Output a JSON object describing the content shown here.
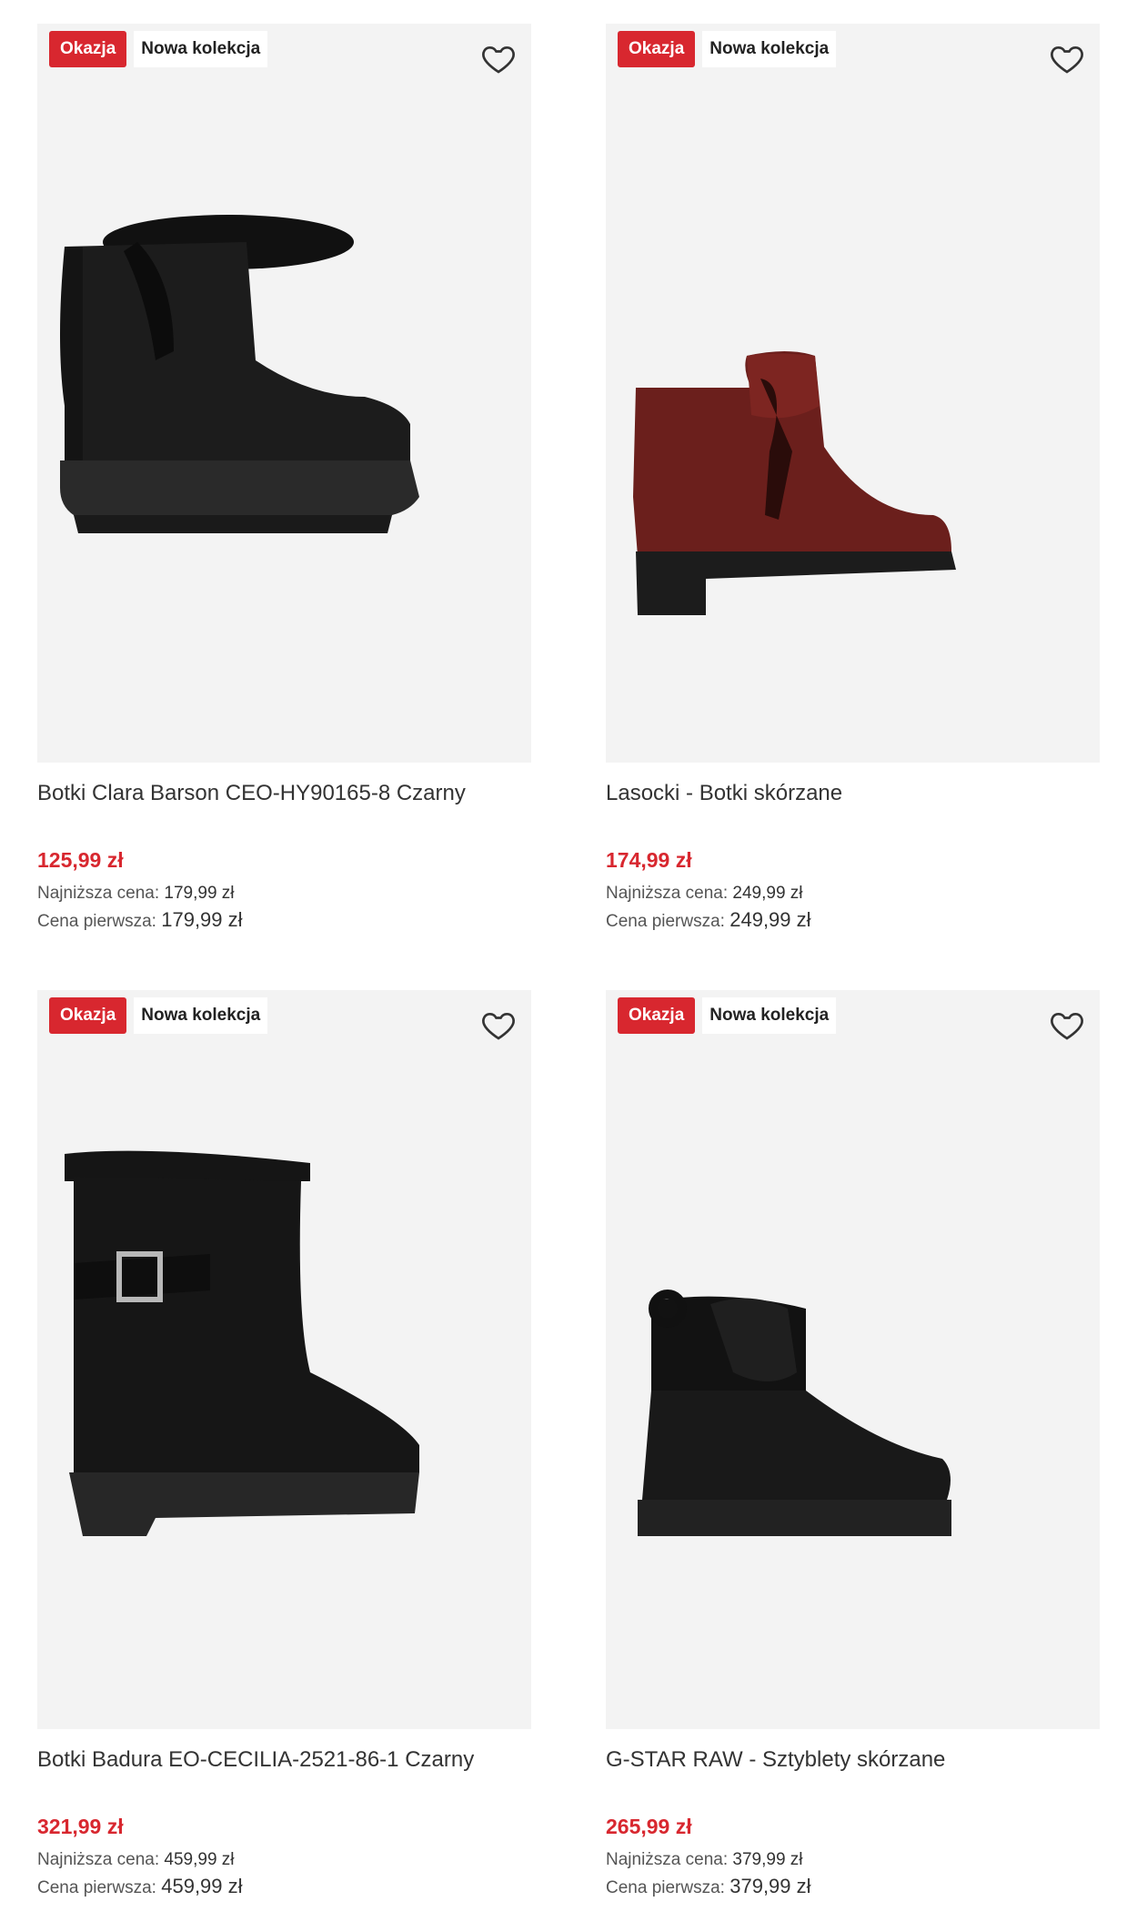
{
  "labels": {
    "sale_badge": "Okazja",
    "new_badge": "Nowa kolekcja",
    "lowest_price_label": "Najniższa cena:",
    "first_price_label": "Cena pierwsza:"
  },
  "products": [
    {
      "name": "Botki Clara Barson CEO-HY90165-8 Czarny",
      "price": "125,99 zł",
      "lowest_price": "179,99 zł",
      "first_price": "179,99 zł",
      "image": "black-suede-fur-boot"
    },
    {
      "name": "Lasocki - Botki skórzane",
      "price": "174,99 zł",
      "lowest_price": "249,99 zł",
      "first_price": "249,99 zł",
      "image": "burgundy-leather-ankle-boot"
    },
    {
      "name": "Botki Badura EO-CECILIA-2521-86-1 Czarny",
      "price": "321,99 zł",
      "lowest_price": "459,99 zł",
      "first_price": "459,99 zł",
      "image": "black-leather-buckle-fur-boot"
    },
    {
      "name": "G-STAR RAW - Sztyblety skórzane",
      "price": "265,99 zł",
      "lowest_price": "379,99 zł",
      "first_price": "379,99 zł",
      "image": "black-chelsea-boot"
    }
  ],
  "colors": {
    "sale": "#d8272f",
    "card_bg": "#f3f3f3"
  }
}
